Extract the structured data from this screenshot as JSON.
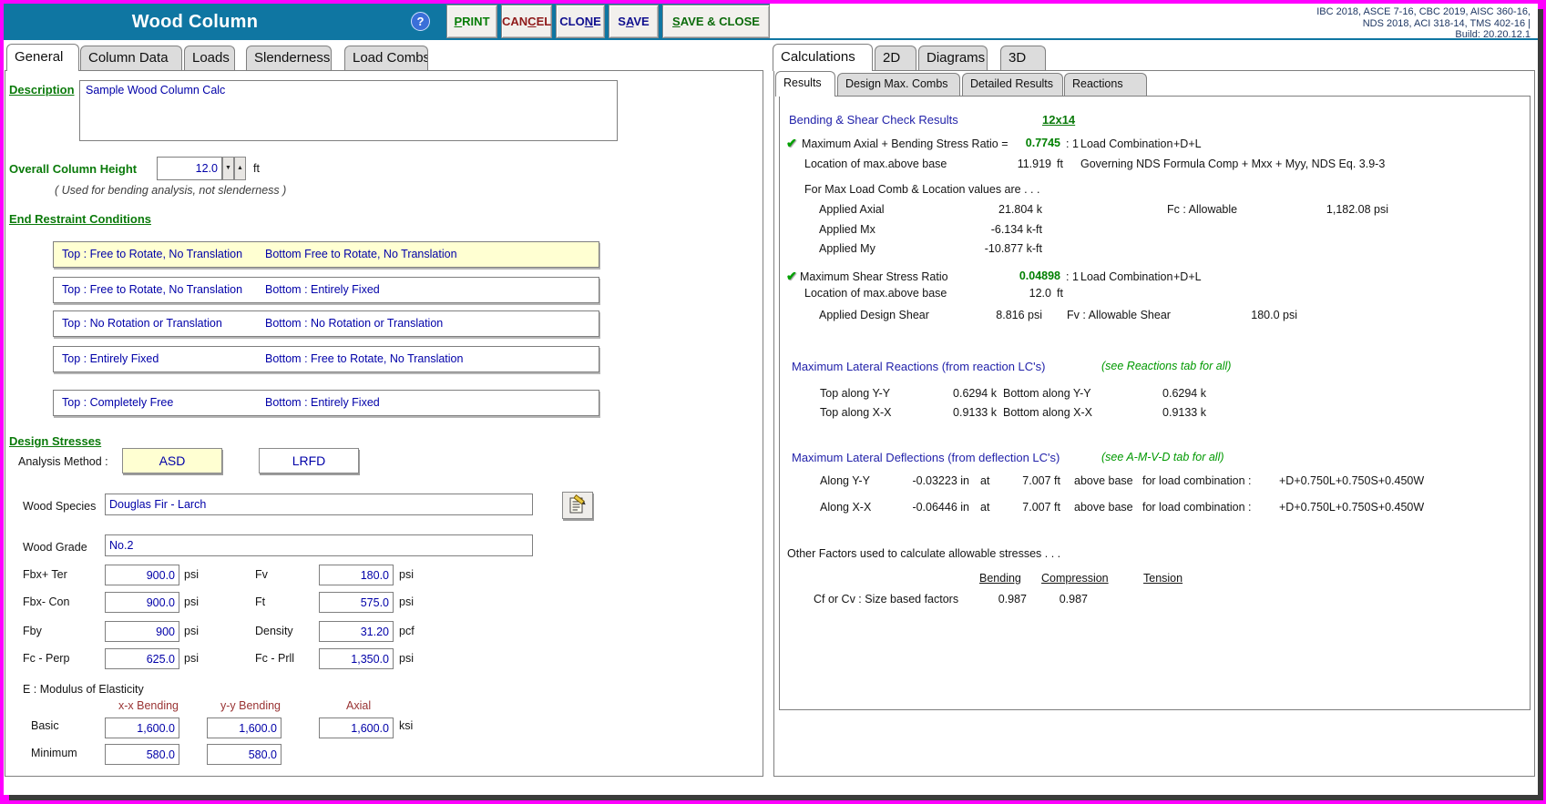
{
  "header": {
    "title": "Wood Column",
    "help": "?",
    "buttons": [
      {
        "label": "PRINT",
        "accel": 0
      },
      {
        "label": "CANCEL",
        "accel": 3
      },
      {
        "label": "CLONE",
        "accel": 3
      },
      {
        "label": "SAVE",
        "accel": 1
      },
      {
        "label": "SAVE & CLOSE",
        "accel": 0
      }
    ],
    "codes": "IBC 2018, ASCE 7-16, CBC 2019, AISC 360-16, NDS 2018, ACI 318-14, TMS 402-16 |",
    "build": "Build: 20.20.12.1"
  },
  "left_tabs": [
    {
      "label": "General",
      "active": true
    },
    {
      "label": "Column Data",
      "active": false
    },
    {
      "label": "Loads",
      "active": false
    },
    {
      "label": "Slenderness",
      "active": false
    },
    {
      "label": "Load Combs",
      "active": false
    }
  ],
  "general": {
    "description_label": "Description",
    "description_value": "Sample Wood Column Calc",
    "height_label": "Overall Column Height",
    "height_value": "12.0",
    "height_unit": "ft",
    "height_note": "( Used for bending analysis, not slenderness )",
    "restraints_label": "End Restraint Conditions",
    "restraint_options": [
      {
        "top": "Top : Free to Rotate,   No Translation",
        "bottom": "Bottom Free to Rotate,   No Translation",
        "selected": true
      },
      {
        "top": "Top : Free to Rotate, No Translation",
        "bottom": "Bottom : Entirely Fixed",
        "selected": false
      },
      {
        "top": "Top : No Rotation or Translation",
        "bottom": "Bottom : No Rotation or Translation",
        "selected": false
      },
      {
        "top": "Top : Entirely Fixed",
        "bottom": "Bottom : Free to Rotate, No Translation",
        "selected": false
      },
      {
        "top": "Top : Completely Free",
        "bottom": "Bottom : Entirely Fixed",
        "selected": false
      }
    ],
    "design_stresses_label": "Design Stresses",
    "analysis_method_label": "Analysis Method :",
    "asd_label": "ASD",
    "asd_selected": true,
    "lrfd_label": "LRFD",
    "wood_species_label": "Wood Species",
    "wood_species": "Douglas Fir - Larch",
    "wood_grade_label": "Wood Grade",
    "wood_grade": "No.2",
    "stress_left": [
      {
        "label": "Fbx+ Ter",
        "value": "900.0",
        "unit": "psi"
      },
      {
        "label": "Fbx- Con",
        "value": "900.0",
        "unit": "psi"
      },
      {
        "label": "Fby",
        "value": "900",
        "unit": "psi"
      },
      {
        "label": "Fc - Perp",
        "value": "625.0",
        "unit": "psi"
      }
    ],
    "stress_right": [
      {
        "label": "Fv",
        "value": "180.0",
        "unit": "psi"
      },
      {
        "label": "Ft",
        "value": "575.0",
        "unit": "psi"
      },
      {
        "label": "Density",
        "value": "31.20",
        "unit": "pcf"
      },
      {
        "label": "Fc - Prll",
        "value": "1,350.0",
        "unit": "psi"
      }
    ],
    "modulus_label": "E : Modulus of Elasticity",
    "modulus_cols": [
      "x-x Bending",
      "y-y Bending",
      "Axial"
    ],
    "basic_label": "Basic",
    "basic_values": [
      "1,600.0",
      "1,600.0",
      "1,600.0"
    ],
    "basic_unit": "ksi",
    "minimum_label": "Minimum",
    "minimum_values": [
      "580.0",
      "580.0"
    ]
  },
  "right_tabs": [
    {
      "label": "Calculations",
      "active": true
    },
    {
      "label": "2D",
      "active": false
    },
    {
      "label": "Diagrams",
      "active": false
    },
    {
      "label": "3D",
      "active": false
    }
  ],
  "calc_tabs": [
    {
      "label": "Results",
      "active": true
    },
    {
      "label": "Design Max. Combs",
      "active": false
    },
    {
      "label": "Detailed Results",
      "active": false
    },
    {
      "label": "Reactions",
      "active": false
    }
  ],
  "results": {
    "section_title": "Bending & Shear Check Results",
    "member_size": "12x14",
    "axial": {
      "label": "Maximum Axial + Bending Stress Ratio  =",
      "ratio": "0.7745",
      "ratio_suffix": ": 1",
      "lc_label": "Load Combination",
      "lc": "+D+L",
      "loc_label": "Location of max.above base",
      "loc": "11.919",
      "loc_unit": "ft",
      "gov_label": "Governing NDS Formula",
      "gov": "Comp + Mxx + Myy, NDS Eq. 3.9-3",
      "for_max": "For Max Load Comb & Location values are . . .",
      "rows": [
        {
          "label": "Applied Axial",
          "value": "21.804 k"
        },
        {
          "label": "Applied Mx",
          "value": "-6.134 k-ft"
        },
        {
          "label": "Applied My",
          "value": "-10.877 k-ft"
        }
      ],
      "fc_label": "Fc : Allowable",
      "fc": "1,182.08 psi"
    },
    "shear": {
      "label": "Maximum Shear Stress Ratio",
      "ratio": "0.04898",
      "ratio_suffix": ": 1",
      "lc_label": "Load Combination",
      "lc": "+D+L",
      "loc_label": "Location of max.above base",
      "loc": "12.0",
      "loc_unit": "ft",
      "applied_label": "Applied Design Shear",
      "applied": "8.816 psi",
      "fv_label": "Fv : Allowable Shear",
      "fv": "180.0 psi"
    },
    "reactions": {
      "title": "Maximum Lateral Reactions (from reaction LC's)",
      "note": "(see Reactions tab for all)",
      "rows": [
        {
          "label_left": "Top along Y-Y",
          "value_left": "0.6294 k",
          "label_right": "Bottom along Y-Y",
          "value_right": "0.6294 k"
        },
        {
          "label_left": "Top along X-X",
          "value_left": "0.9133 k",
          "label_right": "Bottom along X-X",
          "value_right": "0.9133 k"
        }
      ]
    },
    "deflections": {
      "title": "Maximum Lateral Deflections (from deflection LC's)",
      "note": "(see A-M-V-D tab for all)",
      "rows": [
        {
          "axis": "Along Y-Y",
          "value": "-0.03223 in",
          "at": "at",
          "dist": "7.007 ft",
          "above": "above base",
          "for_label": "for load combination :",
          "combo": "+D+0.750L+0.750S+0.450W"
        },
        {
          "axis": "Along X-X",
          "value": "-0.06446 in",
          "at": "at",
          "dist": "7.007 ft",
          "above": "above base",
          "for_label": "for load combination :",
          "combo": "+D+0.750L+0.750S+0.450W"
        }
      ]
    },
    "factors": {
      "title": "Other Factors used to calculate allowable stresses . . .",
      "columns": [
        "Bending",
        "Compression",
        "Tension"
      ],
      "row_label": "Cf or Cv : Size based factors",
      "values": [
        "0.987",
        "0.987"
      ]
    }
  },
  "icons": {
    "help": "?",
    "check": "✔",
    "spin_up": "▲",
    "spin_down": "▼"
  },
  "colors": {
    "window_border": "#FF00FF",
    "header_bar": "#0F76A2",
    "selected_bg": "#FFFFD2",
    "label_green": "#0B7A0B",
    "value_navy": "#0000A8",
    "result_green": "#008000",
    "heading_red": "#993333",
    "codes_navy": "#1F3864"
  }
}
